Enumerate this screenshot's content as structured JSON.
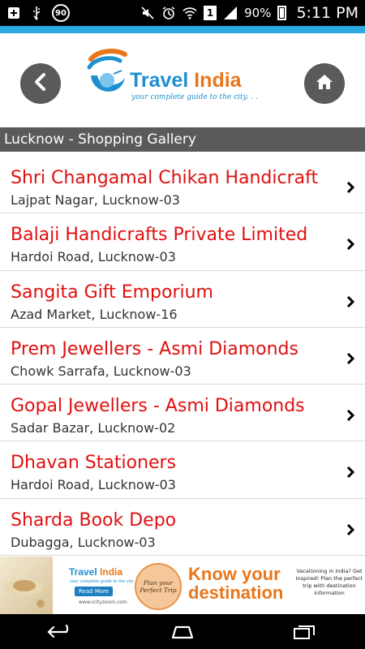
{
  "status_bar": {
    "badge_number": "90",
    "sim_slot": "1",
    "battery_percent": "90%",
    "time": "5:11 PM",
    "icons": [
      "add-notification-icon",
      "usb-icon",
      "circle-badge-icon",
      "mute-icon",
      "alarm-icon",
      "wifi-icon",
      "signal-icon",
      "battery-charging-icon"
    ]
  },
  "header": {
    "logo": {
      "title_part1": "Travel",
      "title_part2": "India",
      "tagline": "your complete guide to the city. . ."
    },
    "back_icon": "chevron-left-icon",
    "home_icon": "home-icon"
  },
  "section": {
    "title": "Lucknow - Shopping Gallery"
  },
  "items": [
    {
      "name": "Shri Changamal Chikan Handicraft",
      "address": "Lajpat Nagar, Lucknow-03"
    },
    {
      "name": "Balaji Handicrafts Private Limited",
      "address": "Hardoi Road, Lucknow-03"
    },
    {
      "name": "Sangita Gift Emporium",
      "address": "Azad Market, Lucknow-16"
    },
    {
      "name": "Prem Jewellers - Asmi Diamonds",
      "address": "Chowk Sarrafa, Lucknow-03"
    },
    {
      "name": "Gopal Jewellers - Asmi Diamonds",
      "address": "Sadar Bazar, Lucknow-02"
    },
    {
      "name": "Dhavan Stationers",
      "address": "Hardoi Road, Lucknow-03"
    },
    {
      "name": "Sharda Book Depo",
      "address": "Dubagga, Lucknow-03"
    }
  ],
  "ad": {
    "logo_part1": "Travel",
    "logo_part2": "India",
    "logo_tagline": "your complete guide to the city",
    "read_more": "Read More",
    "url": "www.icityzoom.com",
    "plan_text": "Plan your Perfect Trip",
    "headline": "Know your destination",
    "body": "Vacationing in India? Get Inspired! Plan the perfect trip with destination information"
  },
  "nav": {
    "icons": [
      "back-nav-icon",
      "home-nav-icon",
      "recent-apps-icon"
    ]
  },
  "colors": {
    "accent_blue": "#29a9e0",
    "item_red": "#e01010",
    "bar_gray": "#5a5a5a",
    "logo_blue": "#1e8fd0",
    "logo_orange": "#e8761b"
  }
}
